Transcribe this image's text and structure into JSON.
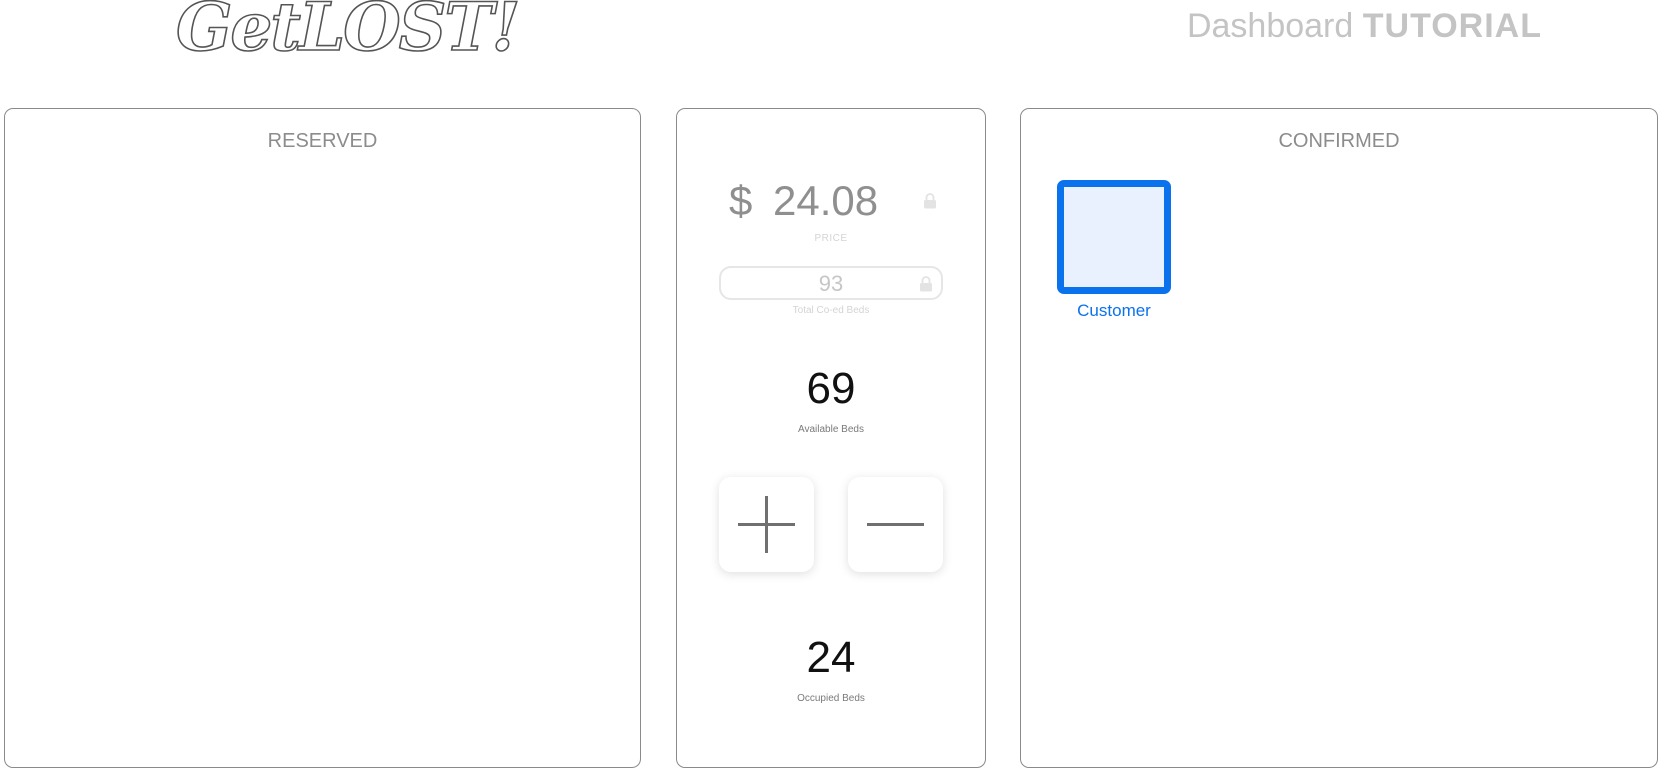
{
  "header": {
    "logo_text": "GetLOST!",
    "title_light": "Dashboard",
    "title_bold": "TUTORIAL"
  },
  "panels": {
    "reserved": {
      "title": "RESERVED"
    },
    "confirmed": {
      "title": "CONFIRMED",
      "cards": [
        {
          "label": "Customer"
        }
      ]
    },
    "center": {
      "price_currency": "$",
      "price_value": "24.08",
      "price_caption": "PRICE",
      "total_beds_value": "93",
      "total_beds_caption": "Total Co-ed Beds",
      "available_value": "69",
      "available_caption": "Available Beds",
      "occupied_value": "24",
      "occupied_caption": "Occupied Beds",
      "increment_icon": "plus-icon",
      "decrement_icon": "minus-icon",
      "lock_icon": "lock-icon"
    }
  },
  "colors": {
    "accent": "#0b72ee",
    "card_fill": "#e8f1fd",
    "panel_border": "#8a8a8a",
    "muted_text": "#8c8c8c"
  }
}
